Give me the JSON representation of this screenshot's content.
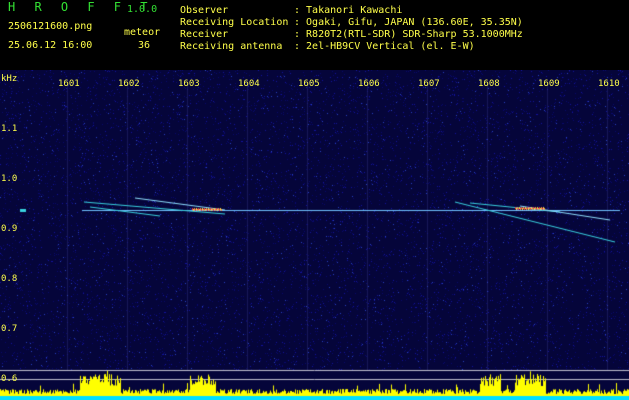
{
  "header": {
    "app_name": "H R O F F T",
    "version": "1.0.0",
    "filename": "2506121600.png",
    "datetime": "25.06.12 16:00",
    "meteor_label": "meteor",
    "meteor_count": "36",
    "observer_label": "Observer",
    "observer_value": ": Takanori Kawachi",
    "location_label": "Receiving Location",
    "location_value": ": Ogaki, Gifu, JAPAN (136.60E, 35.35N)",
    "receiver_label": "Receiver",
    "receiver_value": ": R820T2(RTL-SDR) SDR-Sharp 53.1000MHz",
    "antenna_label": "Receiving antenna",
    "antenna_value": ": 2el-HB9CV Vertical (el. E-W)"
  },
  "axis": {
    "y_unit": "kHz",
    "y_ticks": [
      "1.1",
      "1.0",
      "0.9",
      "0.8",
      "0.7",
      "0.6"
    ],
    "x_ticks": [
      "1601",
      "1602",
      "1603",
      "1604",
      "1605",
      "1606",
      "1607",
      "1608",
      "1609",
      "1610"
    ]
  },
  "colors": {
    "background": "#000000",
    "spectrogram_bg": "#05053a",
    "text": "#ffff4a",
    "brand": "#33e033",
    "power_bar": "#ffff00",
    "baseline": "#00e0ff"
  }
}
